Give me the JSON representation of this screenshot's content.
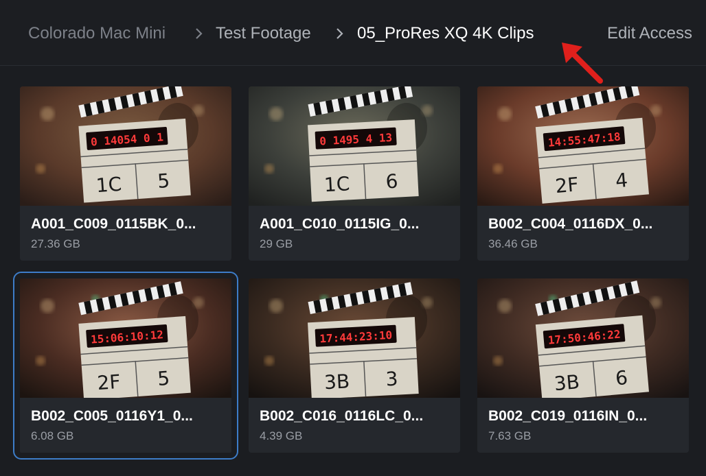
{
  "breadcrumb": {
    "items": [
      {
        "label": "Colorado Mac Mini"
      },
      {
        "label": "Test Footage"
      },
      {
        "label": "05_ProRes XQ 4K Clips"
      }
    ],
    "edit_access_label": "Edit Access"
  },
  "colors": {
    "background": "#1b1d21",
    "card": "#25282d",
    "selected_outline": "#3d7dc9",
    "annotation_arrow": "#e0201c"
  },
  "clips": [
    {
      "name": "A001_C009_0115BK_0...",
      "size": "27.36 GB",
      "timecode": "0 14054 0 1",
      "scene": "1C",
      "take": "5",
      "selected": false
    },
    {
      "name": "A001_C010_0115IG_0...",
      "size": "29 GB",
      "timecode": "0 1495 4 13",
      "scene": "1C",
      "take": "6",
      "selected": false
    },
    {
      "name": "B002_C004_0116DX_0...",
      "size": "36.46 GB",
      "timecode": "14:55:47:18",
      "scene": "2F",
      "take": "4",
      "selected": false
    },
    {
      "name": "B002_C005_0116Y1_0...",
      "size": "6.08 GB",
      "timecode": "15:06:10:12",
      "scene": "2F",
      "take": "5",
      "selected": true
    },
    {
      "name": "B002_C016_0116LC_0...",
      "size": "4.39 GB",
      "timecode": "17:44:23:10",
      "scene": "3B",
      "take": "3",
      "selected": false
    },
    {
      "name": "B002_C019_0116IN_0...",
      "size": "7.63 GB",
      "timecode": "17:50:46:22",
      "scene": "3B",
      "take": "6",
      "selected": false
    }
  ]
}
